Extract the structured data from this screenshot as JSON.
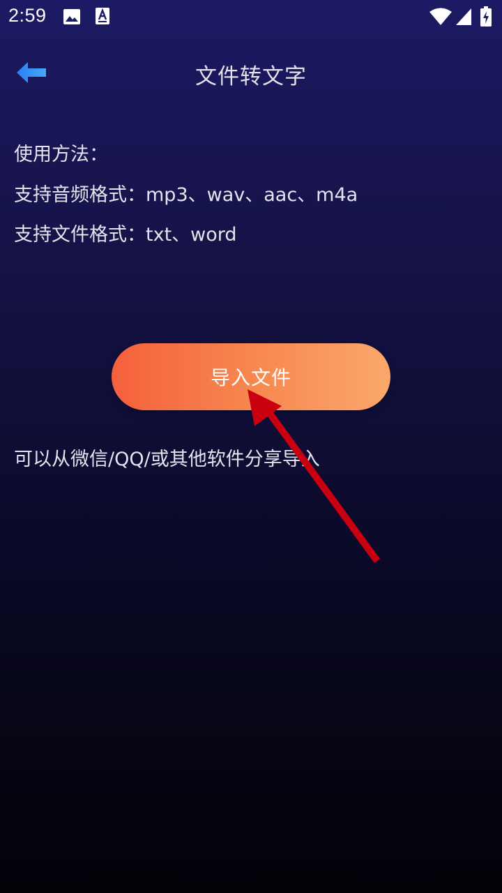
{
  "status_bar": {
    "time": "2:59",
    "icons": [
      "gallery-icon",
      "accessibility-icon",
      "wifi-icon",
      "signal-icon",
      "battery-charging-icon"
    ]
  },
  "toolbar": {
    "back_icon": "back-arrow-icon",
    "title": "文件转文字"
  },
  "instructions": {
    "usage": "使用方法：",
    "audio_formats": "支持音频格式：mp3、wav、aac、m4a",
    "file_formats": "支持文件格式：txt、word"
  },
  "import_button": {
    "label": "导入文件"
  },
  "share_hint": "可以从微信/QQ/或其他软件分享导入",
  "colors": {
    "background_top": "#1c1a63",
    "background_bottom": "#020208",
    "button_gradient_start": "#f5603c",
    "button_gradient_end": "#fba86c",
    "back_arrow": "#2f8ff5",
    "annotation_arrow": "#c8000f"
  }
}
